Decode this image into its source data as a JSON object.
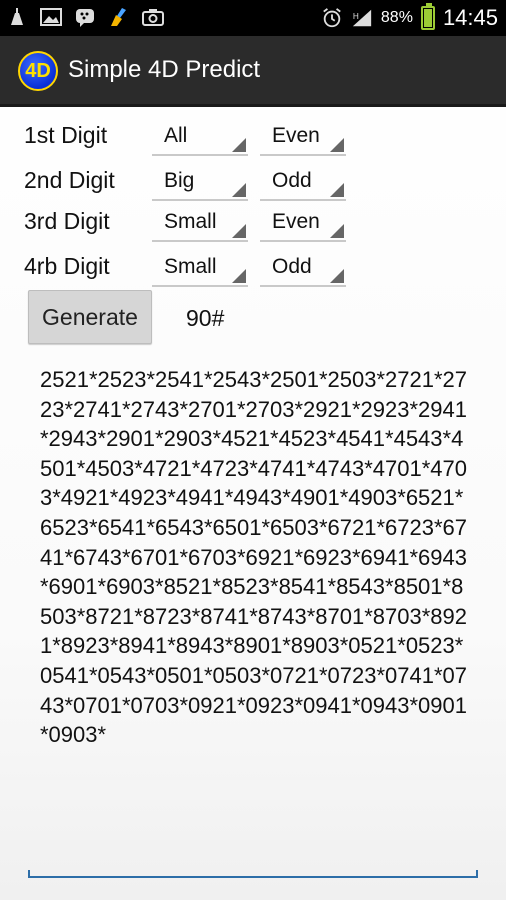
{
  "status_bar": {
    "battery_percent": "88%",
    "battery_level": 0.88,
    "time": "14:45"
  },
  "app": {
    "icon_text": "4D",
    "title": "Simple 4D Predict"
  },
  "rows": [
    {
      "label": "1st Digit",
      "size": "All",
      "parity": "Even"
    },
    {
      "label": "2nd Digit",
      "size": "Big",
      "parity": "Odd"
    },
    {
      "label": "3rd Digit",
      "size": "Small",
      "parity": "Even"
    },
    {
      "label": "4rb Digit",
      "size": "Small",
      "parity": "Odd"
    }
  ],
  "generate_label": "Generate",
  "count_label": "90#",
  "result_text": "2521*2523*2541*2543*2501*2503*2721*2723*2741*2743*2701*2703*2921*2923*2941*2943*2901*2903*4521*4523*4541*4543*4501*4503*4721*4723*4741*4743*4701*4703*4921*4923*4941*4943*4901*4903*6521*6523*6541*6543*6501*6503*6721*6723*6741*6743*6701*6703*6921*6923*6941*6943*6901*6903*8521*8523*8541*8543*8501*8503*8721*8723*8741*8743*8701*8703*8921*8923*8941*8943*8901*8903*0521*0523*0541*0543*0501*0503*0721*0723*0741*0743*0701*0703*0921*0923*0941*0943*0901*0903*",
  "colors": {
    "action_bar": "#2b2b2b",
    "accent": "#2d6ea8",
    "battery": "#9ccc35"
  }
}
